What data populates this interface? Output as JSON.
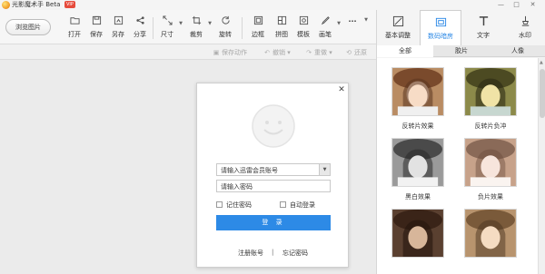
{
  "app": {
    "title": "光影魔术手 Beta",
    "badge": "VIP"
  },
  "window_controls": [
    "—",
    "□",
    "✕"
  ],
  "toolbar": {
    "browse": "浏览图片",
    "tools": [
      {
        "label": "打开",
        "icon": "open-icon"
      },
      {
        "label": "保存",
        "icon": "save-icon"
      },
      {
        "label": "另存",
        "icon": "save-as-icon"
      },
      {
        "label": "分享",
        "icon": "share-icon"
      },
      {
        "label": "尺寸",
        "icon": "resize-icon"
      },
      {
        "label": "裁剪",
        "icon": "crop-icon"
      },
      {
        "label": "旋转",
        "icon": "rotate-icon"
      },
      {
        "label": "边框",
        "icon": "border-icon"
      },
      {
        "label": "拼图",
        "icon": "collage-icon"
      },
      {
        "label": "模板",
        "icon": "template-icon"
      },
      {
        "label": "画笔",
        "icon": "brush-icon"
      },
      {
        "label": "...",
        "icon": "more-icon"
      }
    ]
  },
  "actions": {
    "save_action": "保存动作",
    "undo": "撤销",
    "redo": "重做",
    "restore": "还原"
  },
  "login": {
    "account_placeholder": "请输入迅雷会员账号",
    "password_placeholder": "请输入密码",
    "remember": "记住密码",
    "auto_login": "自动登录",
    "login_button": "登 录",
    "register": "注册账号",
    "separator": "|",
    "forgot": "忘记密码",
    "accent_color": "#2d8ae6"
  },
  "right_panel": {
    "tabs": [
      {
        "label": "基本调整",
        "icon": "adjust-icon",
        "active": false
      },
      {
        "label": "数码暗房",
        "icon": "darkroom-icon",
        "active": true
      },
      {
        "label": "文字",
        "icon": "text-icon",
        "active": false
      },
      {
        "label": "水印",
        "icon": "watermark-icon",
        "active": false
      }
    ],
    "subtabs": [
      "全部",
      "胶片",
      "人像"
    ],
    "effects": [
      "反转片效果",
      "反转片负冲",
      "黑白效果",
      "负片效果",
      "",
      ""
    ]
  }
}
